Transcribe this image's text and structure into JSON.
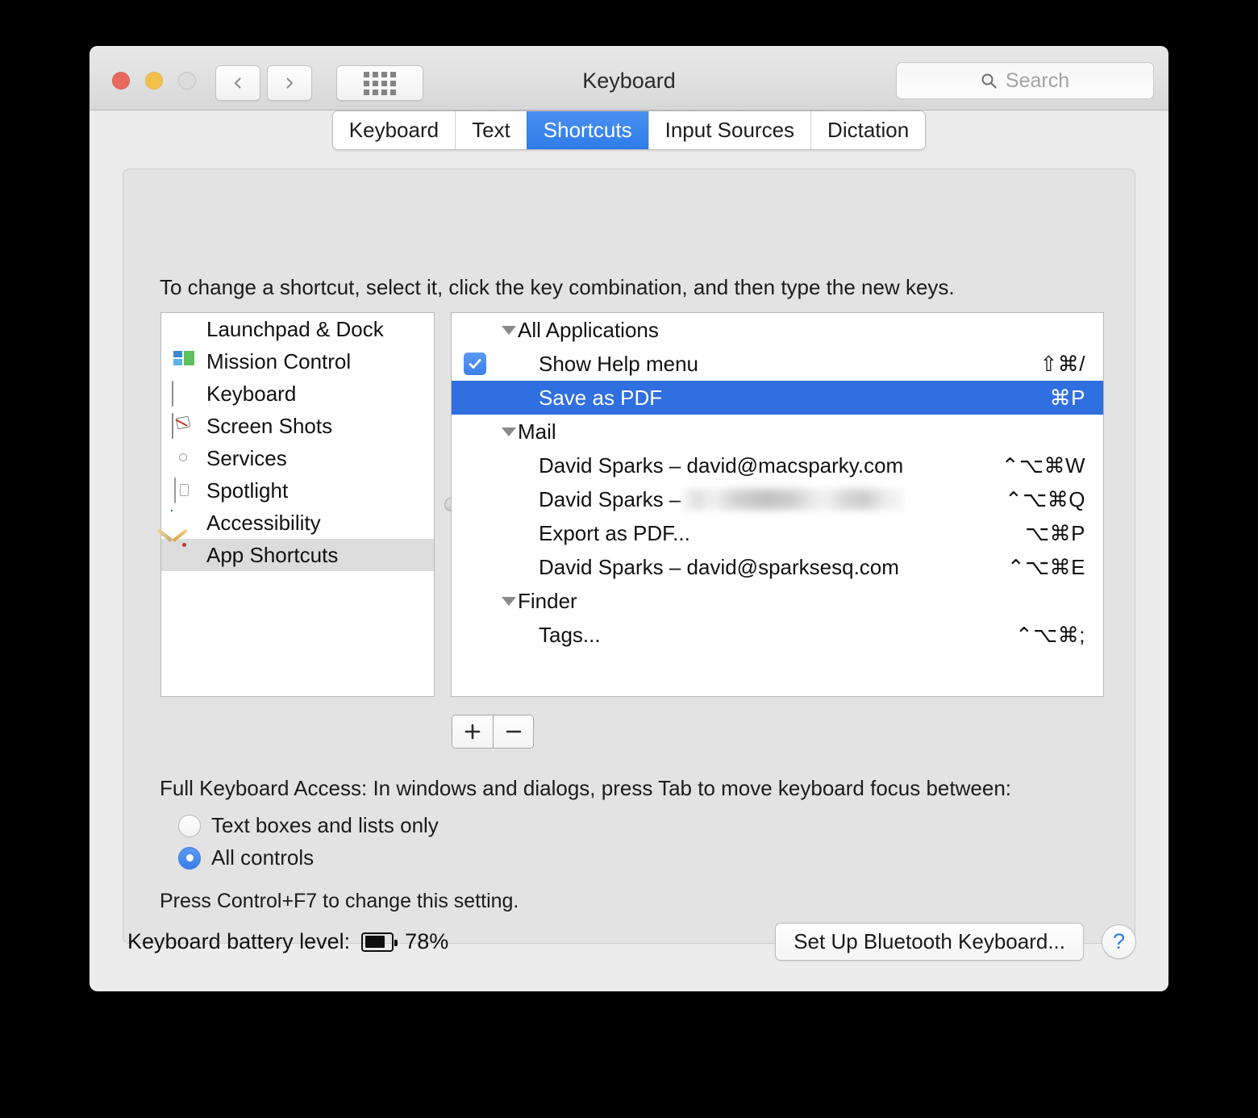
{
  "window": {
    "title": "Keyboard",
    "traffic_lights": [
      "close",
      "minimize",
      "zoom"
    ],
    "nav": {
      "back": "back-icon",
      "forward": "forward-icon",
      "show_all": "grid-icon"
    }
  },
  "search": {
    "placeholder": "Search",
    "icon": "search-icon",
    "value": ""
  },
  "tabs": [
    {
      "label": "Keyboard",
      "active": false
    },
    {
      "label": "Text",
      "active": false
    },
    {
      "label": "Shortcuts",
      "active": true
    },
    {
      "label": "Input Sources",
      "active": false
    },
    {
      "label": "Dictation",
      "active": false
    }
  ],
  "instruction": "To change a shortcut, select it, click the key combination, and then type the new keys.",
  "sidebar": {
    "items": [
      {
        "label": "Launchpad & Dock",
        "icon": "launchpad-dock-icon",
        "selected": false
      },
      {
        "label": "Mission Control",
        "icon": "mission-control-icon",
        "selected": false
      },
      {
        "label": "Keyboard",
        "icon": "keyboard-icon",
        "selected": false
      },
      {
        "label": "Screen Shots",
        "icon": "screen-shots-icon",
        "selected": false
      },
      {
        "label": "Services",
        "icon": "services-gear-icon",
        "selected": false
      },
      {
        "label": "Spotlight",
        "icon": "spotlight-document-icon",
        "selected": false
      },
      {
        "label": "Accessibility",
        "icon": "accessibility-icon",
        "selected": false
      },
      {
        "label": "App Shortcuts",
        "icon": "app-shortcuts-icon",
        "selected": true
      }
    ]
  },
  "shortcuts": {
    "rows": [
      {
        "type": "group",
        "label": "All Applications",
        "expanded": true,
        "key": ""
      },
      {
        "type": "item",
        "label": "Show Help menu",
        "key": "⇧⌘/",
        "checkbox": true,
        "checked": true,
        "selected": false
      },
      {
        "type": "item",
        "label": "Save as PDF",
        "key": "⌘P",
        "checkbox": false,
        "selected": true
      },
      {
        "type": "group",
        "label": "Mail",
        "expanded": true,
        "key": ""
      },
      {
        "type": "item",
        "label": "David Sparks – david@macsparky.com",
        "key": "⌃⌥⌘W",
        "checkbox": false,
        "selected": false
      },
      {
        "type": "item",
        "label": "David Sparks –",
        "key": "⌃⌥⌘Q",
        "checkbox": false,
        "selected": false,
        "redacted": true
      },
      {
        "type": "item",
        "label": "Export as PDF...",
        "key": "⌥⌘P",
        "checkbox": false,
        "selected": false
      },
      {
        "type": "item",
        "label": "David Sparks – david@sparksesq.com",
        "key": "⌃⌥⌘E",
        "checkbox": false,
        "selected": false
      },
      {
        "type": "group",
        "label": "Finder",
        "expanded": true,
        "key": ""
      },
      {
        "type": "item",
        "label": "Tags...",
        "key": "⌃⌥⌘;",
        "checkbox": false,
        "selected": false
      }
    ],
    "add_label": "+",
    "remove_label": "−"
  },
  "full_keyboard_access": {
    "label": "Full Keyboard Access: In windows and dialogs, press Tab to move keyboard focus between:",
    "options": [
      {
        "label": "Text boxes and lists only",
        "selected": false
      },
      {
        "label": "All controls",
        "selected": true
      }
    ],
    "hint": "Press Control+F7 to change this setting."
  },
  "bottom": {
    "battery_label": "Keyboard battery level:",
    "battery_percent": "78%",
    "battery_fill": 78,
    "setup_button": "Set Up Bluetooth Keyboard...",
    "help_button": "?"
  },
  "colors": {
    "accent_blue": "#2f6fe0",
    "tab_blue": "#3b82ef",
    "selection_gray": "#dcdcdc",
    "help_blue": "#2f7cea",
    "window_bg": "#ececec",
    "panel_bg": "#e3e3e3"
  }
}
